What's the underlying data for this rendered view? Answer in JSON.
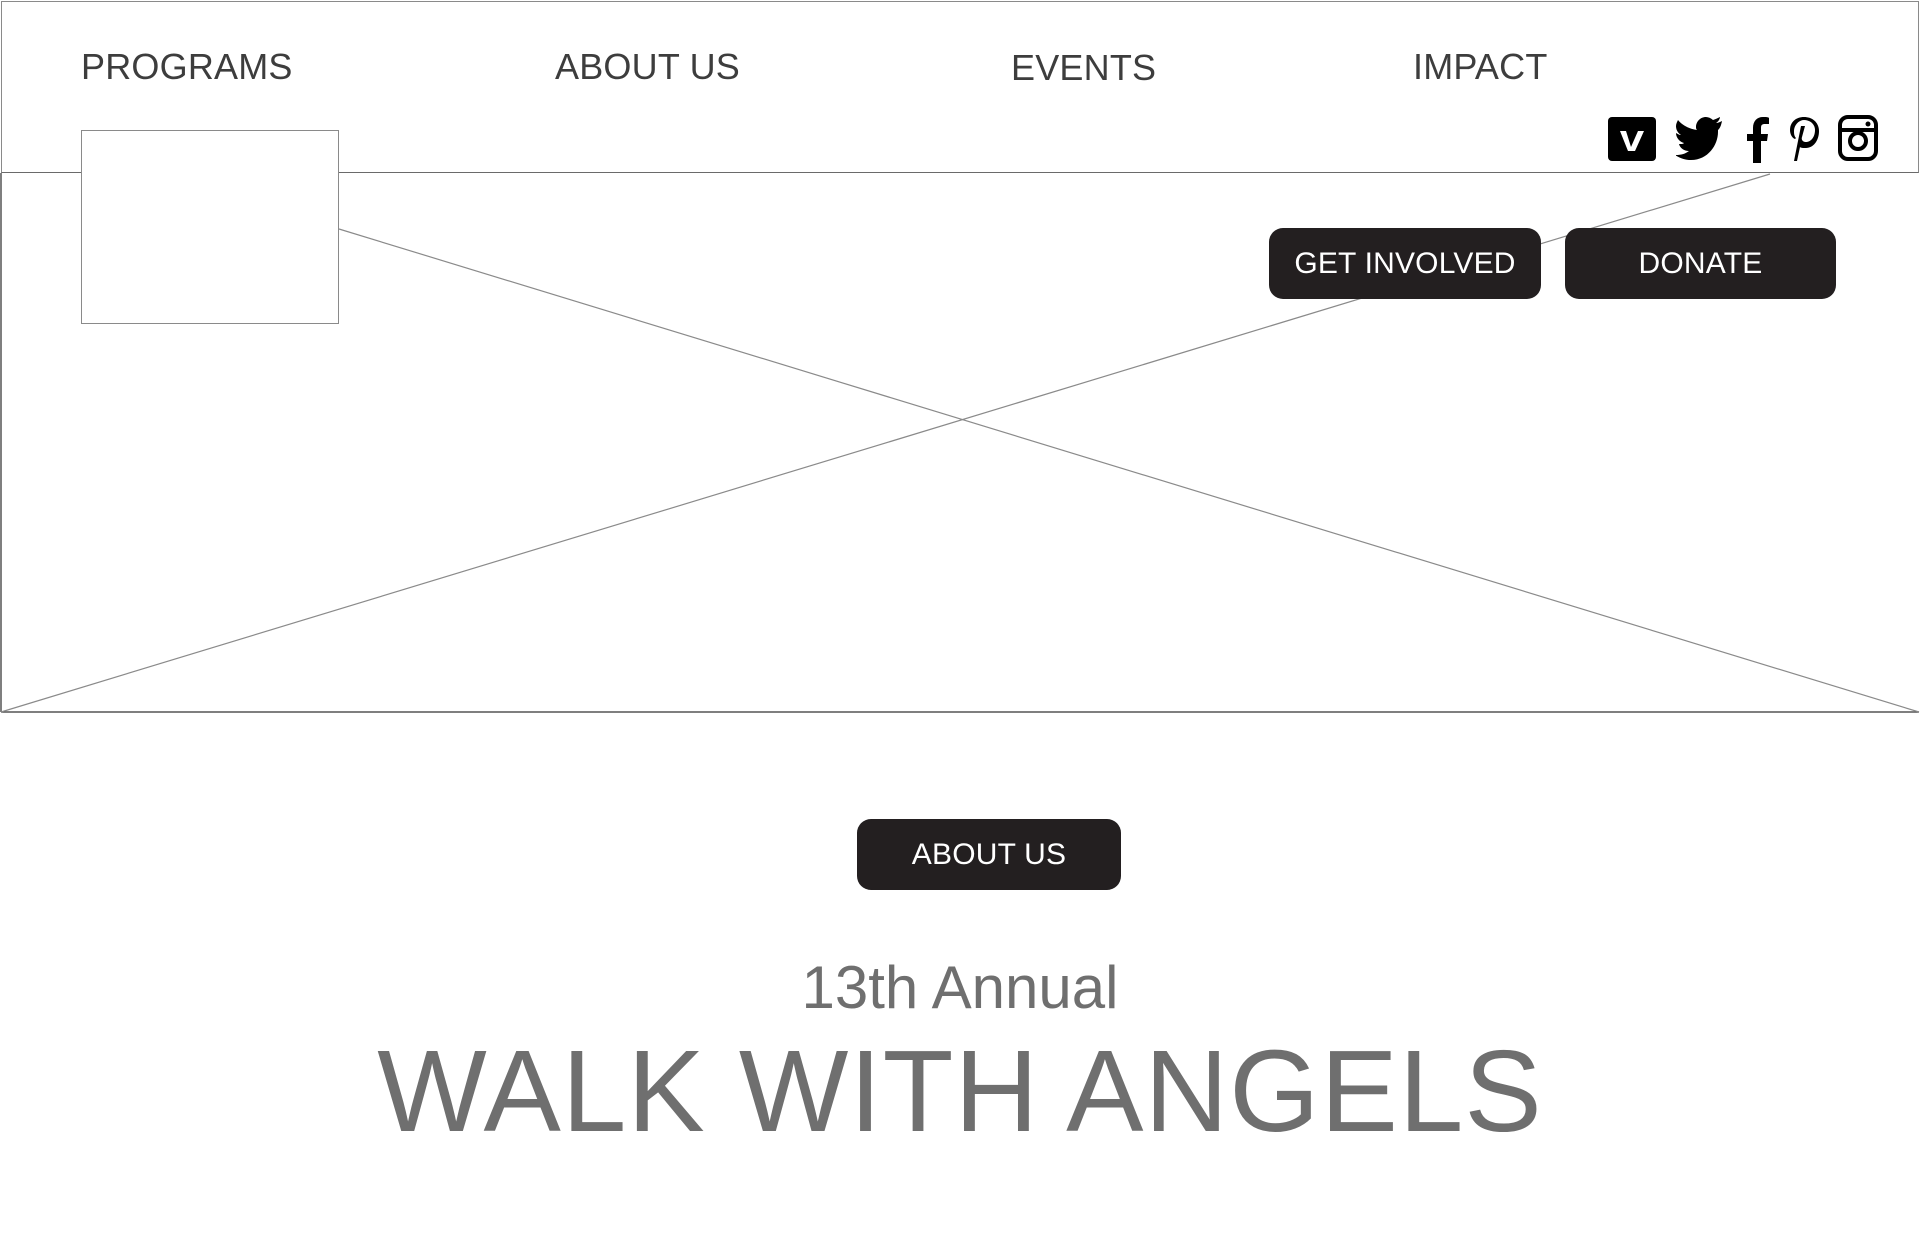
{
  "nav": {
    "items": [
      {
        "label": "PROGRAMS"
      },
      {
        "label": "ABOUT US"
      },
      {
        "label": "EVENTS"
      },
      {
        "label": "IMPACT"
      }
    ]
  },
  "social": {
    "icons": [
      "vimeo-icon",
      "twitter-icon",
      "facebook-icon",
      "pinterest-icon",
      "instagram-icon"
    ]
  },
  "hero": {
    "get_involved_label": "GET INVOLVED",
    "donate_label": "DONATE"
  },
  "section": {
    "about_us_label": "ABOUT US",
    "subtitle": "13th Annual",
    "title": "WALK WITH ANGELS"
  },
  "colors": {
    "button_bg": "#231f20",
    "button_text": "#ffffff",
    "heading_text": "#6f6f6f",
    "nav_text": "#3d3d3d",
    "wireframe_line": "#8a8a8a"
  }
}
